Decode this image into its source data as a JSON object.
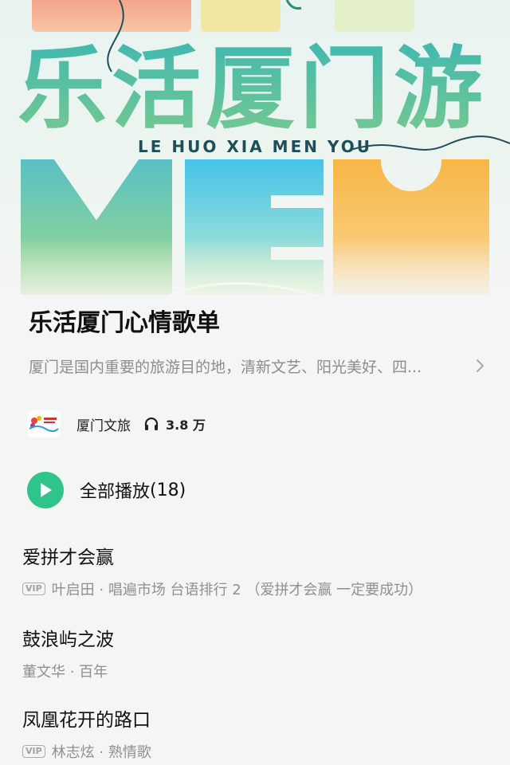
{
  "cover": {
    "title_chars": [
      "乐",
      "活",
      "厦",
      "门",
      "游"
    ],
    "subtitle": "LE HUO XIA MEN YOU"
  },
  "playlist": {
    "title": "乐活厦门心情歌单",
    "description": "厦门是国内重要的旅游目的地，清新文艺、阳光美好、四...",
    "creator": "厦门文旅",
    "play_count": "3.8 万"
  },
  "play_all": {
    "label": "全部播放",
    "count": "(18)"
  },
  "songs": [
    {
      "title": "爱拼才会赢",
      "vip": "VIP",
      "meta": "叶启田 · 唱遍市场 台语排行 2 （爱拼才会赢 一定要成功）"
    },
    {
      "title": "鼓浪屿之波",
      "vip": "",
      "meta": "董文华 · 百年"
    },
    {
      "title": "凤凰花开的路口",
      "vip": "VIP",
      "meta": "林志炫 · 熟情歌"
    }
  ],
  "icons": {
    "chevron": "chevron-right-icon",
    "headphones": "headphones-icon",
    "play": "play-icon"
  },
  "colors": {
    "accent": "#30c48a",
    "title_dark": "#1e4f58",
    "muted": "#8a8e91"
  }
}
